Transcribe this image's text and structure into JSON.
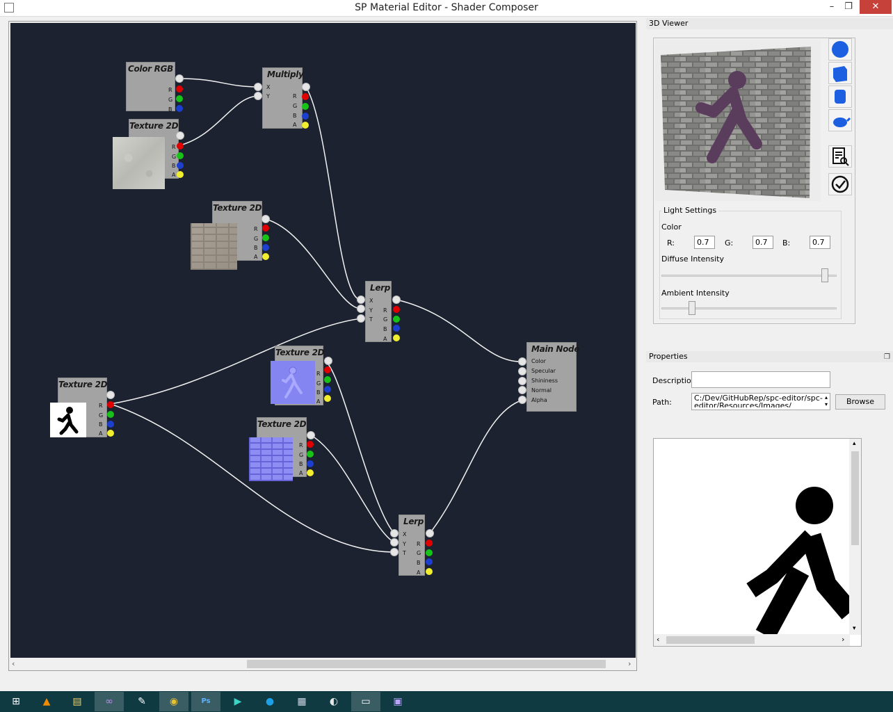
{
  "window": {
    "title": "SP Material Editor - Shader Composer",
    "minimize_glyph": "–",
    "maximize_glyph": "❐",
    "close_glyph": "✕"
  },
  "graph": {
    "nodes": {
      "color_rgb": {
        "title": "Color RGB",
        "ports": [
          "R",
          "G",
          "B"
        ]
      },
      "texture1": {
        "title": "Texture 2D",
        "ports": [
          "R",
          "G",
          "B",
          "A"
        ]
      },
      "multiply": {
        "title": "Multiply",
        "inputs": [
          "X",
          "Y"
        ],
        "ports": [
          "R",
          "G",
          "B",
          "A"
        ]
      },
      "texture2": {
        "title": "Texture 2D",
        "ports": [
          "R",
          "G",
          "B",
          "A"
        ]
      },
      "lerp1": {
        "title": "Lerp",
        "inputs": [
          "X",
          "Y",
          "T"
        ],
        "ports": [
          "R",
          "G",
          "B",
          "A"
        ]
      },
      "texture3": {
        "title": "Texture 2D",
        "ports": [
          "R",
          "G",
          "B",
          "A"
        ]
      },
      "main": {
        "title": "Main Node",
        "inputs": [
          "Color",
          "Specular",
          "Shininess",
          "Normal",
          "Alpha"
        ]
      },
      "texture4": {
        "title": "Texture 2D",
        "ports": [
          "R",
          "G",
          "B",
          "A"
        ]
      },
      "texture5": {
        "title": "Texture 2D",
        "ports": [
          "R",
          "G",
          "B",
          "A"
        ]
      },
      "lerp2": {
        "title": "Lerp",
        "inputs": [
          "X",
          "Y",
          "T"
        ],
        "ports": [
          "R",
          "G",
          "B",
          "A"
        ]
      }
    }
  },
  "viewer": {
    "header": "3D Viewer",
    "tools": [
      "sphere-icon",
      "cube-icon",
      "cylinder-icon",
      "teapot-icon",
      "inspect-document-icon",
      "validate-check-icon"
    ],
    "light": {
      "legend": "Light Settings",
      "color_label": "Color",
      "r_label": "R:",
      "g_label": "G:",
      "b_label": "B:",
      "r": "0.7",
      "g": "0.7",
      "b": "0.7",
      "diffuse_label": "Diffuse Intensity",
      "diffuse_level": 0.95,
      "ambient_label": "Ambient Intensity",
      "ambient_level": 0.16
    }
  },
  "properties": {
    "header": "Properties",
    "description_label": "Descriptior",
    "description_value": "",
    "path_label": "Path:",
    "path_line1": "C:/Dev/GitHubRep/spc-editor/spc-",
    "path_line2": "editor/Resources/Images/",
    "browse_label": "Browse"
  },
  "taskbar": {
    "items": [
      "windows-start-icon",
      "vlc-icon",
      "file-explorer-icon",
      "visual-studio-icon",
      "notepad-icon",
      "chrome-icon",
      "photoshop-icon",
      "azure-icon",
      "skype-icon",
      "calculator-icon",
      "paint-icon",
      "shader-composer-icon",
      "media-icon"
    ]
  },
  "colors": {
    "canvas_bg": "#1d2230",
    "node_bg": "#a3a3a3",
    "wire": "#f2f2f2",
    "port_r": "#e00000",
    "port_g": "#17c317",
    "port_b": "#1c3fd0",
    "port_a": "#f0ee2e",
    "taskbar": "#0f3a42",
    "close_button": "#c7413b"
  }
}
